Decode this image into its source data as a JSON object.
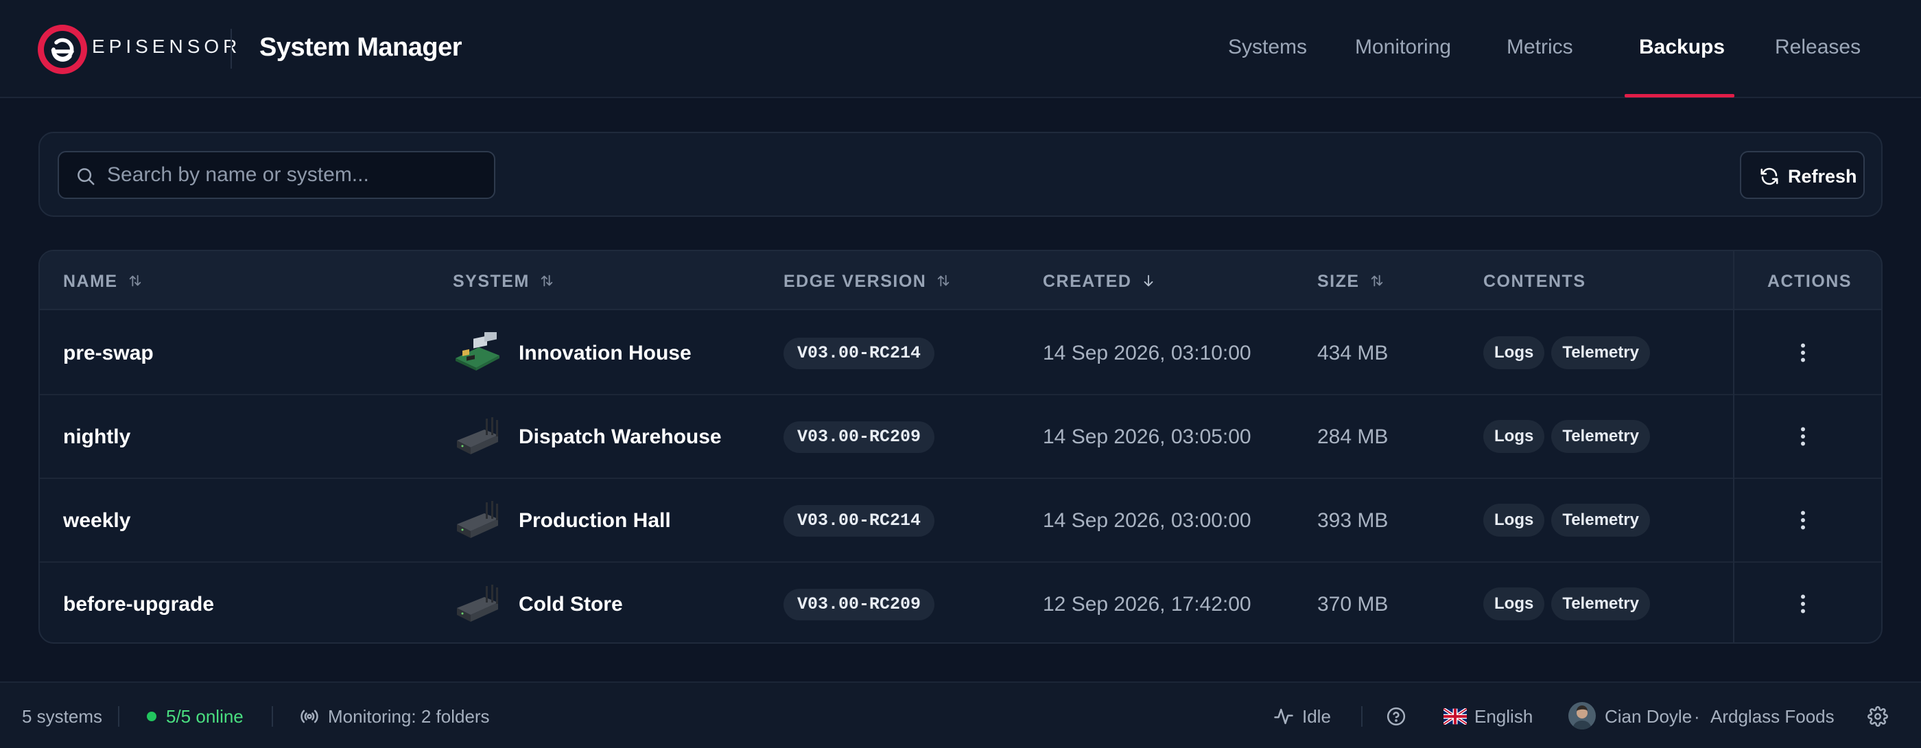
{
  "brand": {
    "logo_text": "EPISENSOR",
    "accent": "#e11d48"
  },
  "app": {
    "title": "System Manager"
  },
  "nav": {
    "items": [
      {
        "label": "Systems"
      },
      {
        "label": "Monitoring"
      },
      {
        "label": "Metrics"
      },
      {
        "label": "Backups",
        "active": true
      },
      {
        "label": "Releases"
      }
    ]
  },
  "search": {
    "placeholder": "Search by name or system...",
    "value": ""
  },
  "toolbar": {
    "refresh_label": "Refresh"
  },
  "table": {
    "headers": {
      "name": "NAME",
      "system": "SYSTEM",
      "edge_version": "EDGE VERSION",
      "created": "CREATED",
      "size": "SIZE",
      "contents": "CONTENTS",
      "actions": "ACTIONS"
    },
    "rows": [
      {
        "name": "pre-swap",
        "system": "Innovation House",
        "device": "board",
        "version": "V03.00-RC214",
        "created": "14 Sep 2026, 03:10:00",
        "size": "434 MB",
        "contents": [
          "Logs",
          "Telemetry"
        ]
      },
      {
        "name": "nightly",
        "system": "Dispatch Warehouse",
        "device": "router",
        "version": "V03.00-RC209",
        "created": "14 Sep 2026, 03:05:00",
        "size": "284 MB",
        "contents": [
          "Logs",
          "Telemetry"
        ]
      },
      {
        "name": "weekly",
        "system": "Production Hall",
        "device": "router",
        "version": "V03.00-RC214",
        "created": "14 Sep 2026, 03:00:00",
        "size": "393 MB",
        "contents": [
          "Logs",
          "Telemetry"
        ]
      },
      {
        "name": "before-upgrade",
        "system": "Cold Store",
        "device": "router",
        "version": "V03.00-RC209",
        "created": "12 Sep 2026, 17:42:00",
        "size": "370 MB",
        "contents": [
          "Logs",
          "Telemetry"
        ]
      }
    ]
  },
  "footer": {
    "systems_count": "5 systems",
    "online": "5/5 online",
    "monitoring": "Monitoring: 2 folders",
    "status": "Idle",
    "language": "English",
    "user": "Cian Doyle",
    "separator": "·",
    "org": "Ardglass Foods"
  }
}
